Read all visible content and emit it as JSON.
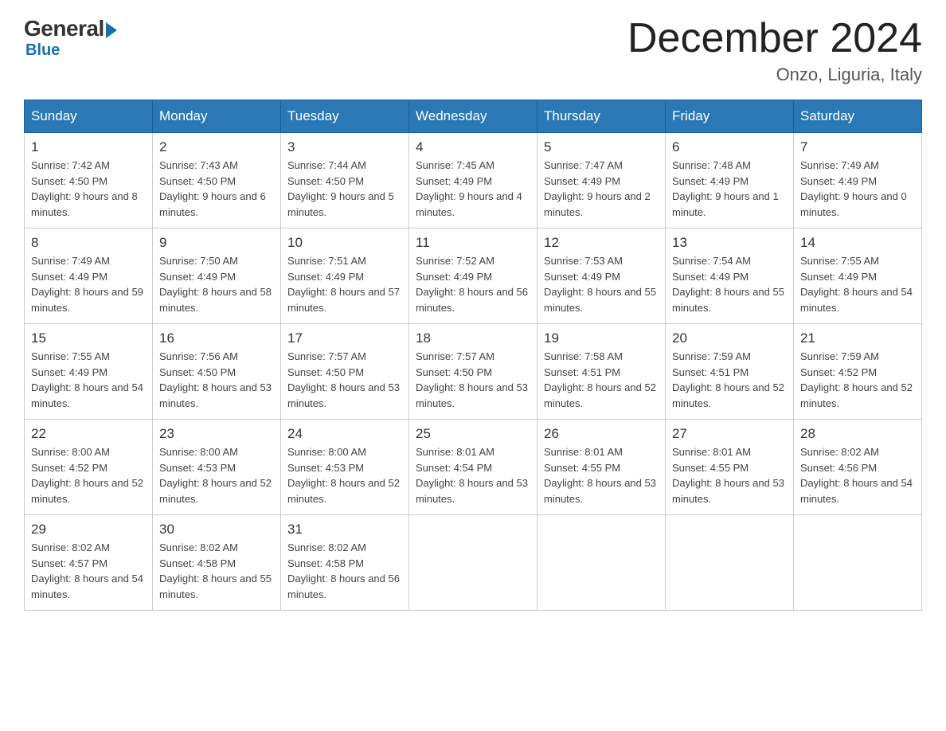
{
  "logo": {
    "general": "General",
    "blue": "Blue"
  },
  "header": {
    "title": "December 2024",
    "subtitle": "Onzo, Liguria, Italy"
  },
  "days_of_week": [
    "Sunday",
    "Monday",
    "Tuesday",
    "Wednesday",
    "Thursday",
    "Friday",
    "Saturday"
  ],
  "weeks": [
    [
      {
        "day": "1",
        "sunrise": "7:42 AM",
        "sunset": "4:50 PM",
        "daylight": "9 hours and 8 minutes."
      },
      {
        "day": "2",
        "sunrise": "7:43 AM",
        "sunset": "4:50 PM",
        "daylight": "9 hours and 6 minutes."
      },
      {
        "day": "3",
        "sunrise": "7:44 AM",
        "sunset": "4:50 PM",
        "daylight": "9 hours and 5 minutes."
      },
      {
        "day": "4",
        "sunrise": "7:45 AM",
        "sunset": "4:49 PM",
        "daylight": "9 hours and 4 minutes."
      },
      {
        "day": "5",
        "sunrise": "7:47 AM",
        "sunset": "4:49 PM",
        "daylight": "9 hours and 2 minutes."
      },
      {
        "day": "6",
        "sunrise": "7:48 AM",
        "sunset": "4:49 PM",
        "daylight": "9 hours and 1 minute."
      },
      {
        "day": "7",
        "sunrise": "7:49 AM",
        "sunset": "4:49 PM",
        "daylight": "9 hours and 0 minutes."
      }
    ],
    [
      {
        "day": "8",
        "sunrise": "7:49 AM",
        "sunset": "4:49 PM",
        "daylight": "8 hours and 59 minutes."
      },
      {
        "day": "9",
        "sunrise": "7:50 AM",
        "sunset": "4:49 PM",
        "daylight": "8 hours and 58 minutes."
      },
      {
        "day": "10",
        "sunrise": "7:51 AM",
        "sunset": "4:49 PM",
        "daylight": "8 hours and 57 minutes."
      },
      {
        "day": "11",
        "sunrise": "7:52 AM",
        "sunset": "4:49 PM",
        "daylight": "8 hours and 56 minutes."
      },
      {
        "day": "12",
        "sunrise": "7:53 AM",
        "sunset": "4:49 PM",
        "daylight": "8 hours and 55 minutes."
      },
      {
        "day": "13",
        "sunrise": "7:54 AM",
        "sunset": "4:49 PM",
        "daylight": "8 hours and 55 minutes."
      },
      {
        "day": "14",
        "sunrise": "7:55 AM",
        "sunset": "4:49 PM",
        "daylight": "8 hours and 54 minutes."
      }
    ],
    [
      {
        "day": "15",
        "sunrise": "7:55 AM",
        "sunset": "4:49 PM",
        "daylight": "8 hours and 54 minutes."
      },
      {
        "day": "16",
        "sunrise": "7:56 AM",
        "sunset": "4:50 PM",
        "daylight": "8 hours and 53 minutes."
      },
      {
        "day": "17",
        "sunrise": "7:57 AM",
        "sunset": "4:50 PM",
        "daylight": "8 hours and 53 minutes."
      },
      {
        "day": "18",
        "sunrise": "7:57 AM",
        "sunset": "4:50 PM",
        "daylight": "8 hours and 53 minutes."
      },
      {
        "day": "19",
        "sunrise": "7:58 AM",
        "sunset": "4:51 PM",
        "daylight": "8 hours and 52 minutes."
      },
      {
        "day": "20",
        "sunrise": "7:59 AM",
        "sunset": "4:51 PM",
        "daylight": "8 hours and 52 minutes."
      },
      {
        "day": "21",
        "sunrise": "7:59 AM",
        "sunset": "4:52 PM",
        "daylight": "8 hours and 52 minutes."
      }
    ],
    [
      {
        "day": "22",
        "sunrise": "8:00 AM",
        "sunset": "4:52 PM",
        "daylight": "8 hours and 52 minutes."
      },
      {
        "day": "23",
        "sunrise": "8:00 AM",
        "sunset": "4:53 PM",
        "daylight": "8 hours and 52 minutes."
      },
      {
        "day": "24",
        "sunrise": "8:00 AM",
        "sunset": "4:53 PM",
        "daylight": "8 hours and 52 minutes."
      },
      {
        "day": "25",
        "sunrise": "8:01 AM",
        "sunset": "4:54 PM",
        "daylight": "8 hours and 53 minutes."
      },
      {
        "day": "26",
        "sunrise": "8:01 AM",
        "sunset": "4:55 PM",
        "daylight": "8 hours and 53 minutes."
      },
      {
        "day": "27",
        "sunrise": "8:01 AM",
        "sunset": "4:55 PM",
        "daylight": "8 hours and 53 minutes."
      },
      {
        "day": "28",
        "sunrise": "8:02 AM",
        "sunset": "4:56 PM",
        "daylight": "8 hours and 54 minutes."
      }
    ],
    [
      {
        "day": "29",
        "sunrise": "8:02 AM",
        "sunset": "4:57 PM",
        "daylight": "8 hours and 54 minutes."
      },
      {
        "day": "30",
        "sunrise": "8:02 AM",
        "sunset": "4:58 PM",
        "daylight": "8 hours and 55 minutes."
      },
      {
        "day": "31",
        "sunrise": "8:02 AM",
        "sunset": "4:58 PM",
        "daylight": "8 hours and 56 minutes."
      },
      null,
      null,
      null,
      null
    ]
  ]
}
